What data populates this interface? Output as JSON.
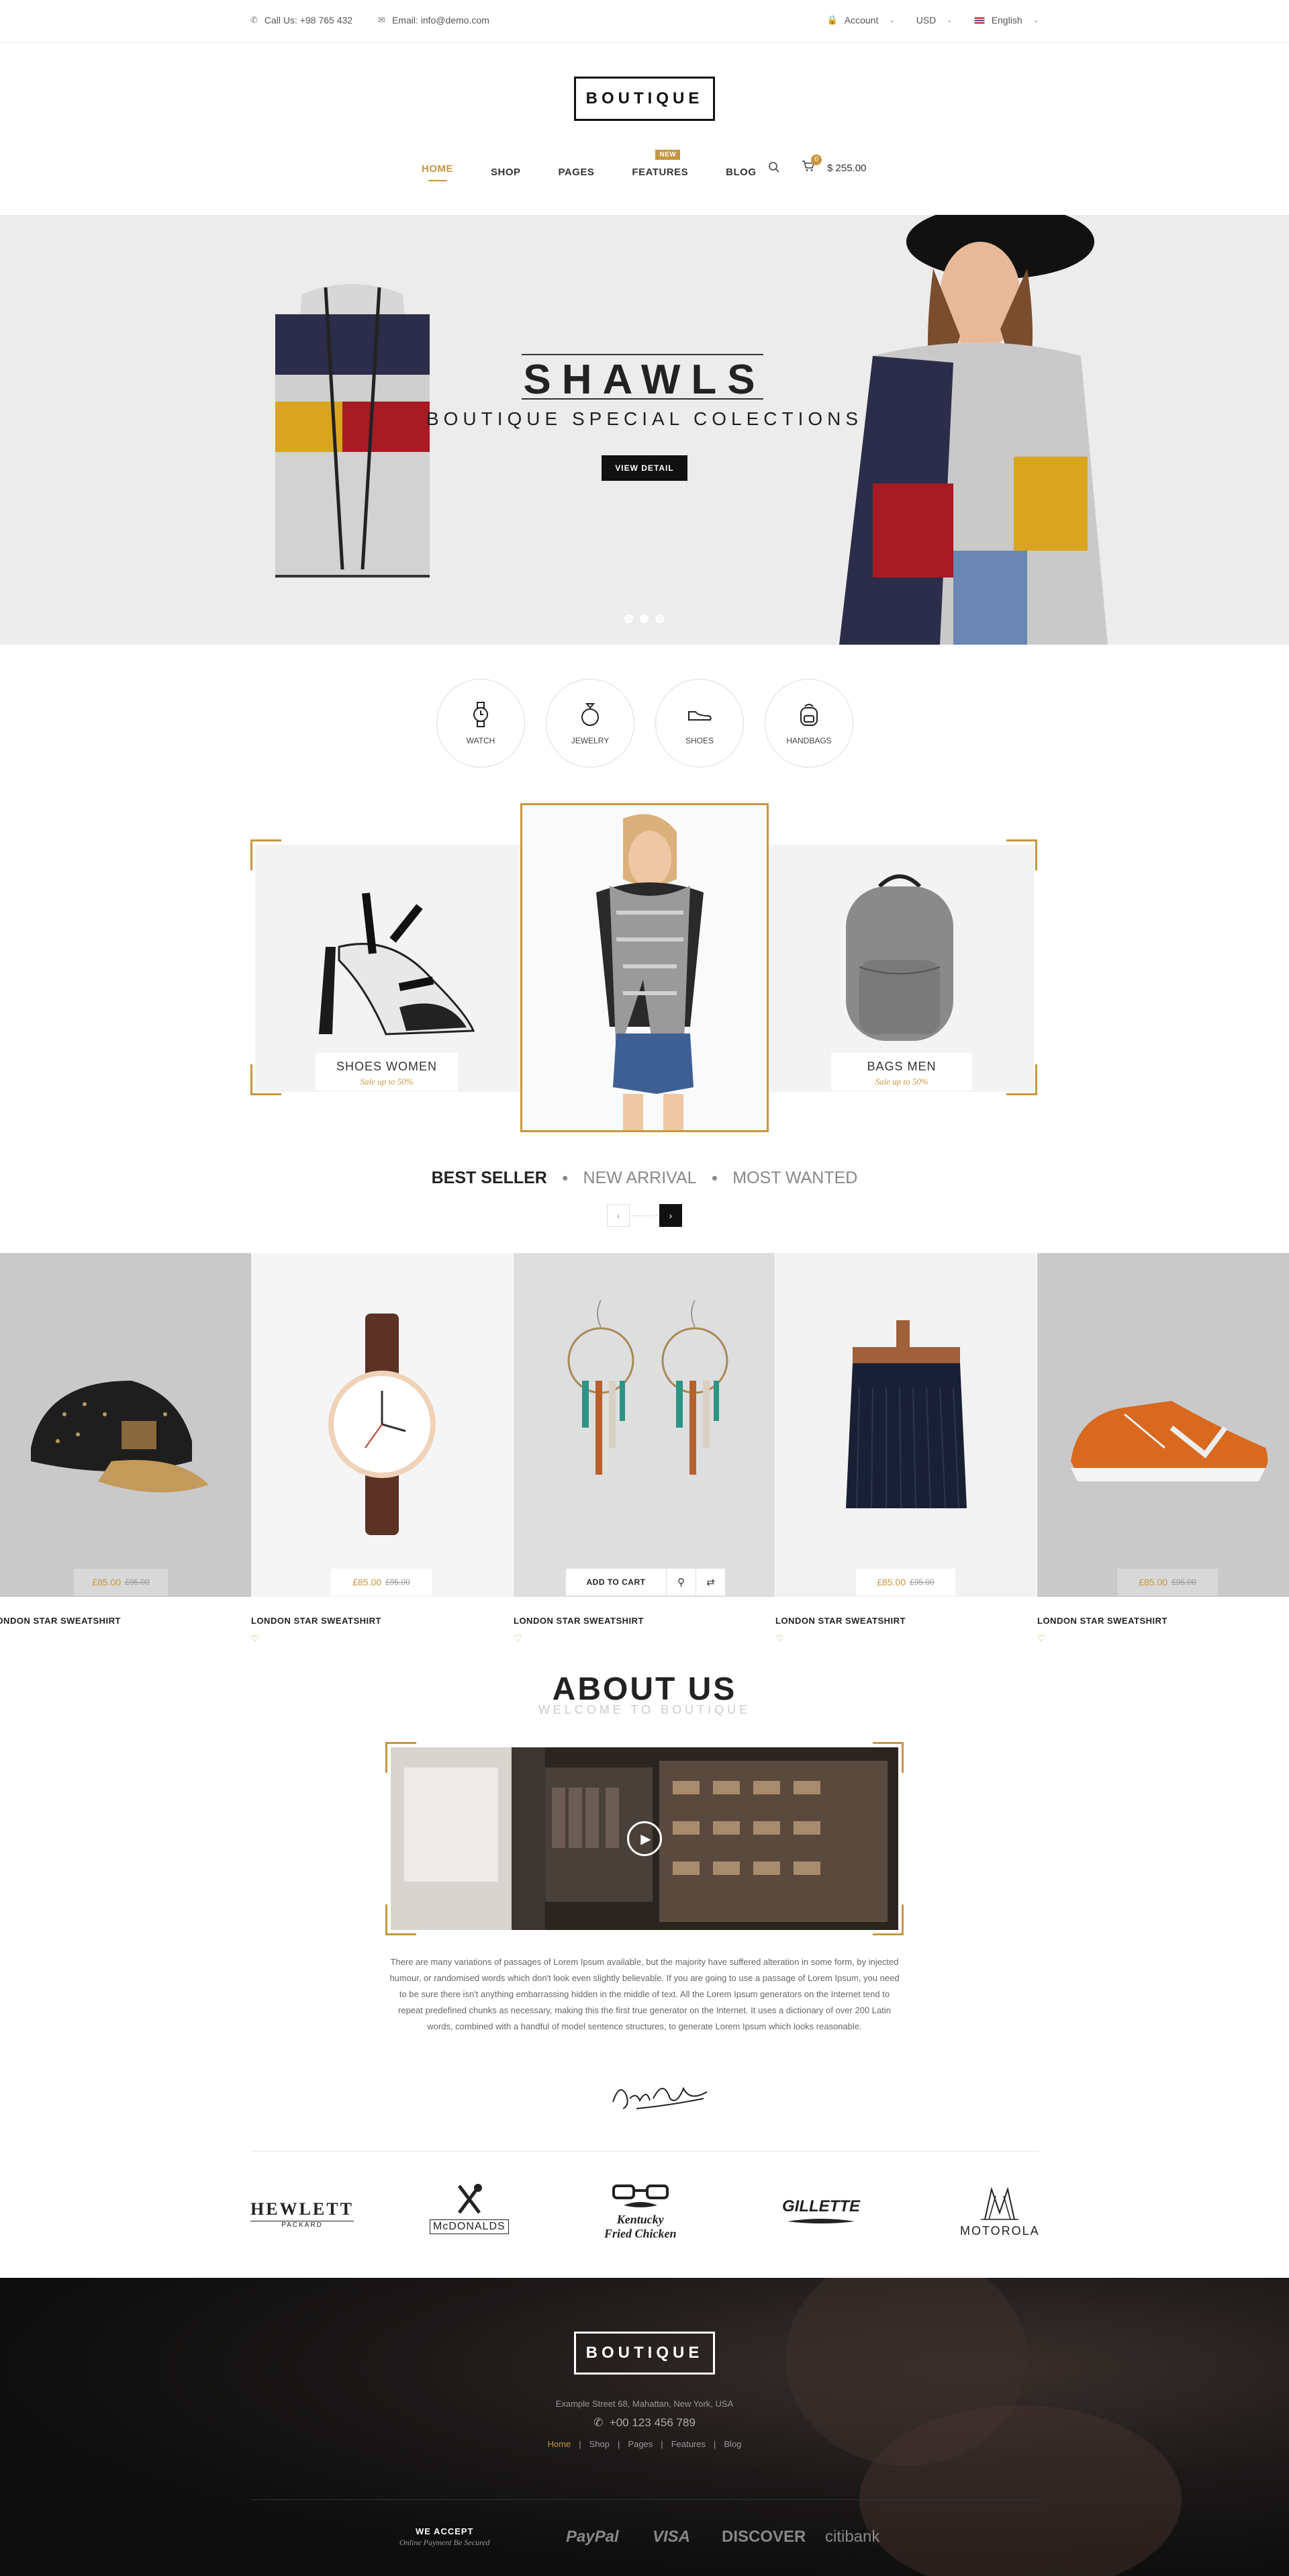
{
  "topbar": {
    "phone": "Call Us: +98 765 432",
    "email": "Email: info@demo.com",
    "account": "Account",
    "currency": "USD",
    "language": "English"
  },
  "logo": "BOUTIQUE",
  "nav": {
    "items": [
      "HOME",
      "SHOP",
      "PAGES",
      "FEATURES",
      "BLOG"
    ],
    "badge": "NEW",
    "cart_count": "0",
    "cart_total": "$ 255.00"
  },
  "hero": {
    "title": "SHAWLS",
    "subtitle": "BOUTIQUE SPECIAL COLECTIONS",
    "button": "VIEW DETAIL"
  },
  "categories": [
    "WATCH",
    "JEWELRY",
    "SHOES",
    "HANDBAGS"
  ],
  "promos": [
    {
      "title": "SHOES WOMEN",
      "subtitle": "Sale up to 50%"
    },
    {
      "title": "BAGS MEN",
      "subtitle": "Sale up to 50%"
    }
  ],
  "tabs": [
    "BEST SELLER",
    "NEW ARRIVAL",
    "MOST WANTED"
  ],
  "products": [
    {
      "name": "LONDON STAR SWEATSHIRT",
      "price": "£85.00",
      "old_price": "£95.00"
    },
    {
      "name": "LONDON STAR SWEATSHIRT",
      "price": "£85.00",
      "old_price": "£95.00"
    },
    {
      "name": "LONDON STAR SWEATSHIRT",
      "add_to_cart": "ADD TO CART"
    },
    {
      "name": "LONDON STAR SWEATSHIRT",
      "price": "£85.00",
      "old_price": "£95.00"
    },
    {
      "name": "LONDON STAR SWEATSHIRT",
      "price": "£85.00",
      "old_price": "£95.00"
    }
  ],
  "about": {
    "title": "ABOUT US",
    "subtitle": "WELCOME TO BOUTIQUE",
    "text": "There are many variations of passages of Lorem Ipsum available, but the majority have suffered alteration in some form, by injected humour, or randomised words which don't look even slightly believable. If you are going to use a passage of Lorem Ipsum, you need to be sure there isn't anything embarrassing hidden in the middle of text. All the Lorem Ipsum generators on the Internet tend to repeat predefined chunks as necessary, making this the first true generator on the Internet. It uses a dictionary of over 200 Latin words, combined with a handful of model sentence structures, to generate Lorem Ipsum which looks reasonable.",
    "signature": "George Barty"
  },
  "brands": [
    "HEWLETT",
    "PACKARD",
    "McDONALDS",
    "Kentucky",
    "Fried Chicken",
    "GILLETTE",
    "MOTOROLA"
  ],
  "footer": {
    "logo": "BOUTIQUE",
    "address": "Example Street 68, Mahattan, New York, USA",
    "phone": "+00 123 456 789",
    "links": [
      "Home",
      "Shop",
      "Pages",
      "Features",
      "Blog"
    ],
    "accept_title": "WE ACCEPT",
    "accept_sub": "Online Payment Be Secured",
    "payments": [
      "PayPal",
      "VISA",
      "DISCOVER",
      "citibank"
    ]
  },
  "colors": {
    "accent": "#c8963e",
    "dark": "#111111",
    "hero_bg": "#ececec"
  }
}
